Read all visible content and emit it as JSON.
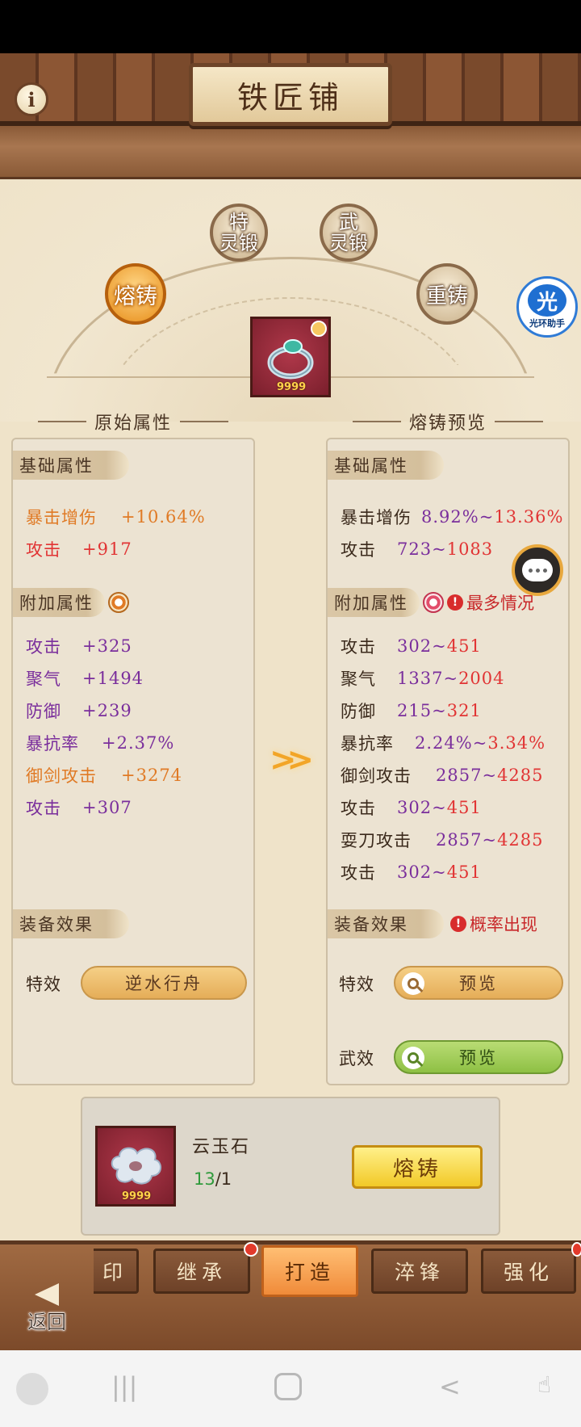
{
  "title": "铁匠铺",
  "forge_modes": {
    "smelt": "熔铸",
    "special": [
      "特",
      "灵锻"
    ],
    "martial": [
      "武",
      "灵锻"
    ],
    "recast": "重铸"
  },
  "item": {
    "count": "9999"
  },
  "helper": {
    "glyph": "光",
    "label": "光环助手"
  },
  "left": {
    "section_title": "原始属性",
    "basic_tag": "基础属性",
    "basic": [
      {
        "name": "暴击增伤",
        "value": "+10.64%"
      },
      {
        "name": "攻击",
        "value": "+917"
      }
    ],
    "extra_tag": "附加属性",
    "extra": [
      {
        "name": "攻击",
        "value": "+325"
      },
      {
        "name": "聚气",
        "value": "+1494"
      },
      {
        "name": "防御",
        "value": "+239"
      },
      {
        "name": "暴抗率",
        "value": "+2.37%"
      },
      {
        "name": "御剑攻击",
        "value": "+3274"
      },
      {
        "name": "攻击",
        "value": "+307"
      }
    ],
    "effect_tag": "装备效果",
    "effect_label": "特效",
    "effect_value": "逆水行舟"
  },
  "right": {
    "section_title": "熔铸预览",
    "basic_tag": "基础属性",
    "basic": [
      {
        "name": "暴击增伤",
        "min": "8.92%",
        "sep": "~",
        "max": "13.36%"
      },
      {
        "name": "攻击",
        "min": "723",
        "sep": "~",
        "max": "1083"
      }
    ],
    "extra_tag": "附加属性",
    "extra_warn": "最多情况",
    "extra": [
      {
        "name": "攻击",
        "min": "302",
        "sep": "~",
        "max": "451"
      },
      {
        "name": "聚气",
        "min": "1337",
        "sep": "~",
        "max": "2004"
      },
      {
        "name": "防御",
        "min": "215",
        "sep": "~",
        "max": "321"
      },
      {
        "name": "暴抗率",
        "min": "2.24%",
        "sep": "~",
        "max": "3.34%"
      },
      {
        "name": "御剑攻击",
        "min": "2857",
        "sep": "~",
        "max": "4285"
      },
      {
        "name": "攻击",
        "min": "302",
        "sep": "~",
        "max": "451"
      },
      {
        "name": "耍刀攻击",
        "min": "2857",
        "sep": "~",
        "max": "4285"
      },
      {
        "name": "攻击",
        "min": "302",
        "sep": "~",
        "max": "451"
      }
    ],
    "effect_tag": "装备效果",
    "effect_warn": "概率出现",
    "special_label": "特效",
    "special_btn": "预览",
    "martial_label": "武效",
    "martial_btn": "预览"
  },
  "material": {
    "name": "云玉石",
    "have": "13",
    "need": "/1",
    "count": "9999",
    "forge_button": "熔铸"
  },
  "tabs": [
    "印",
    "继承",
    "打造",
    "淬锋",
    "强化"
  ],
  "active_tab": "打造",
  "back_label": "返回",
  "colors": {
    "accent": "#f08b3a",
    "highlight": "#f2c927",
    "attr_purple": "#7a2e9c",
    "attr_orange": "#e07a25",
    "range_red": "#e13434"
  }
}
